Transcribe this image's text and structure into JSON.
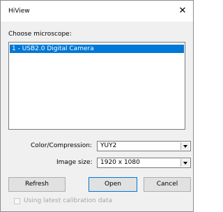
{
  "window": {
    "title": "HiView",
    "close_icon": "close-icon"
  },
  "microscope": {
    "label": "Choose microscope:",
    "items": [
      {
        "label": "1 - USB2.0 Digital Camera",
        "selected": true
      }
    ]
  },
  "color": {
    "label": "Color/Compression:",
    "value": "YUY2"
  },
  "image_size": {
    "label": "Image size:",
    "value": "1920 x 1080"
  },
  "buttons": {
    "refresh": "Refresh",
    "open": "Open",
    "cancel": "Cancel"
  },
  "calibration": {
    "label": "Using latest calibration data",
    "checked": false,
    "enabled": false
  },
  "colors": {
    "selection": "#0078d7",
    "dialog_bg": "#f0f0f0",
    "disabled_text": "#a6a6a6"
  }
}
